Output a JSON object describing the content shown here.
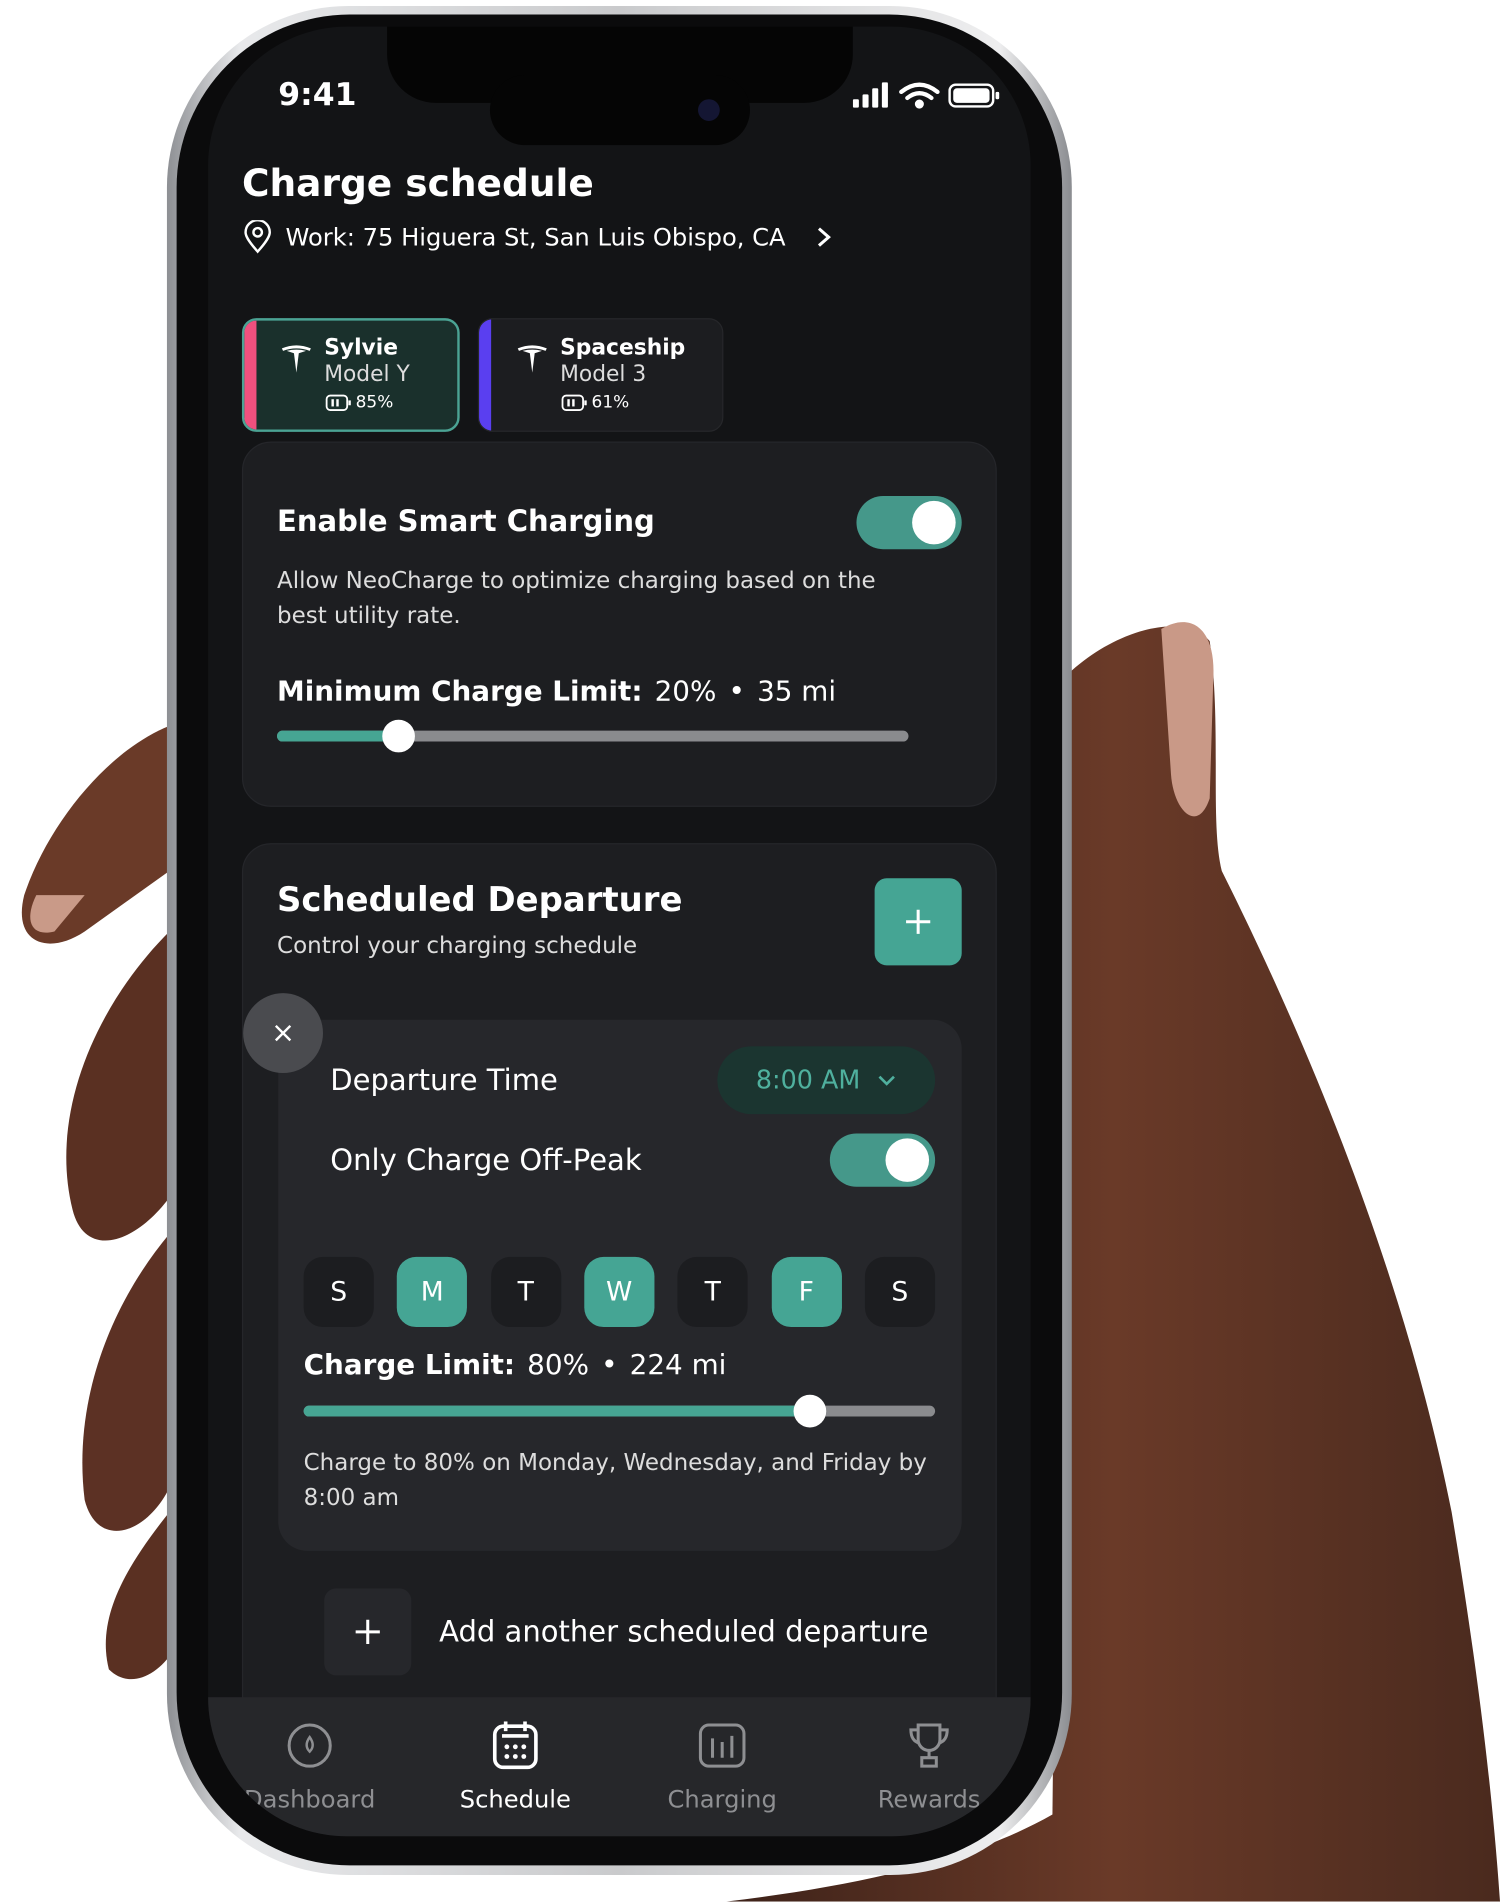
{
  "status_bar": {
    "time": "9:41"
  },
  "header": {
    "title": "Charge schedule",
    "location": "Work: 75 Higuera St, San Luis Obispo, CA"
  },
  "vehicles": [
    {
      "name": "Sylvie",
      "model": "Model Y",
      "battery": "85%",
      "accent": "#f0507e",
      "selected": true
    },
    {
      "name": "Spaceship",
      "model": "Model 3",
      "battery": "61%",
      "accent": "#5a3ff0",
      "selected": false
    }
  ],
  "smart_charging": {
    "title": "Enable Smart Charging",
    "enabled": true,
    "description_line1": "Allow NeoCharge to optimize charging based on the",
    "description_line2": "best utility rate.",
    "min_label": "Minimum Charge Limit:",
    "min_percent": "20%",
    "separator": "•",
    "min_range": "35 mi",
    "min_value": 20
  },
  "departure": {
    "title": "Scheduled Departure",
    "subtitle": "Control your charging schedule",
    "entry": {
      "time_label": "Departure Time",
      "time_value": "8:00 AM",
      "offpeak_label": "Only Charge Off-Peak",
      "offpeak_enabled": true,
      "days": [
        {
          "l": "S",
          "on": false
        },
        {
          "l": "M",
          "on": true
        },
        {
          "l": "T",
          "on": false
        },
        {
          "l": "W",
          "on": true
        },
        {
          "l": "T",
          "on": false
        },
        {
          "l": "F",
          "on": true
        },
        {
          "l": "S",
          "on": false
        }
      ],
      "limit_label": "Charge Limit:",
      "limit_percent": "80%",
      "separator": "•",
      "limit_range": "224 mi",
      "limit_value": 80,
      "summary_line1": "Charge to 80% on Monday, Wednesday, and Friday by",
      "summary_line2": "8:00 am"
    },
    "add_label": "Add another scheduled departure"
  },
  "nav": [
    {
      "label": "Dashboard",
      "icon": "gauge-icon"
    },
    {
      "label": "Schedule",
      "icon": "calendar-icon",
      "active": true
    },
    {
      "label": "Charging",
      "icon": "bar-chart-icon"
    },
    {
      "label": "Rewards",
      "icon": "trophy-icon"
    }
  ],
  "colors": {
    "accent": "#45a594",
    "background": "#131416",
    "card": "#1d1e21"
  }
}
